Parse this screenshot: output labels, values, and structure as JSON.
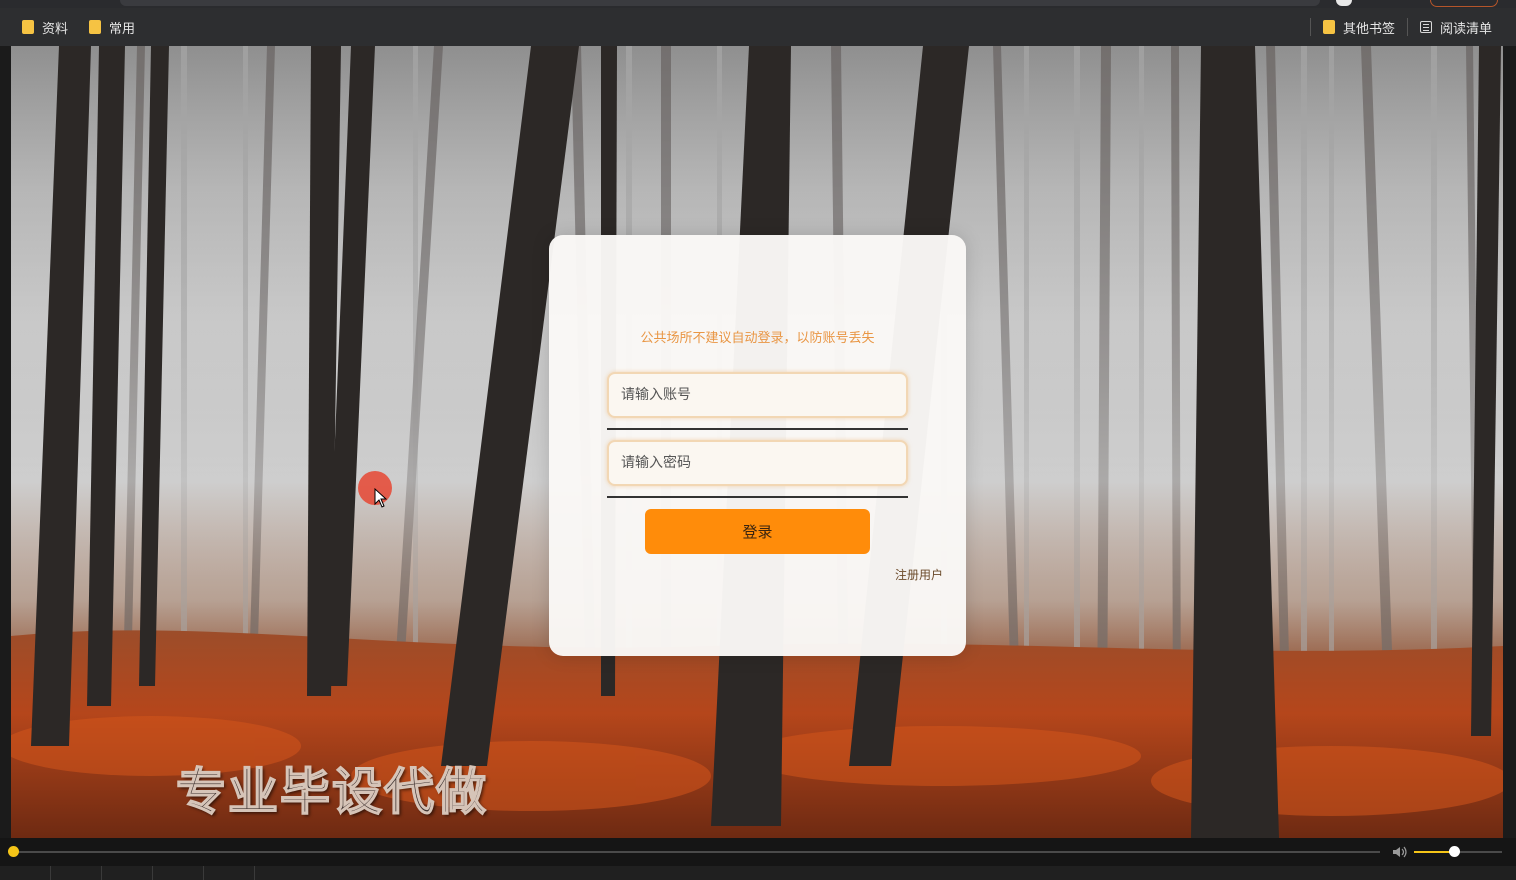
{
  "bookmarks_bar": {
    "left_items": [
      {
        "label": "资料",
        "icon": "folder-icon"
      },
      {
        "label": "常用",
        "icon": "folder-icon"
      }
    ],
    "right_items": [
      {
        "label": "其他书签",
        "icon": "folder-icon"
      },
      {
        "label": "阅读清单",
        "icon": "reading-list-icon"
      }
    ]
  },
  "login": {
    "notice": "公共场所不建议自动登录，以防账号丢失",
    "account_placeholder": "请输入账号",
    "password_placeholder": "请输入密码",
    "submit_label": "登录",
    "register_label": "注册用户"
  },
  "watermark": "专业毕设代做",
  "player": {
    "progress": 0.0,
    "volume": 0.45
  },
  "colors": {
    "accent": "#ff8c0a",
    "notice": "#e99644",
    "folder": "#f6c343",
    "player_accent": "#f5c518"
  }
}
